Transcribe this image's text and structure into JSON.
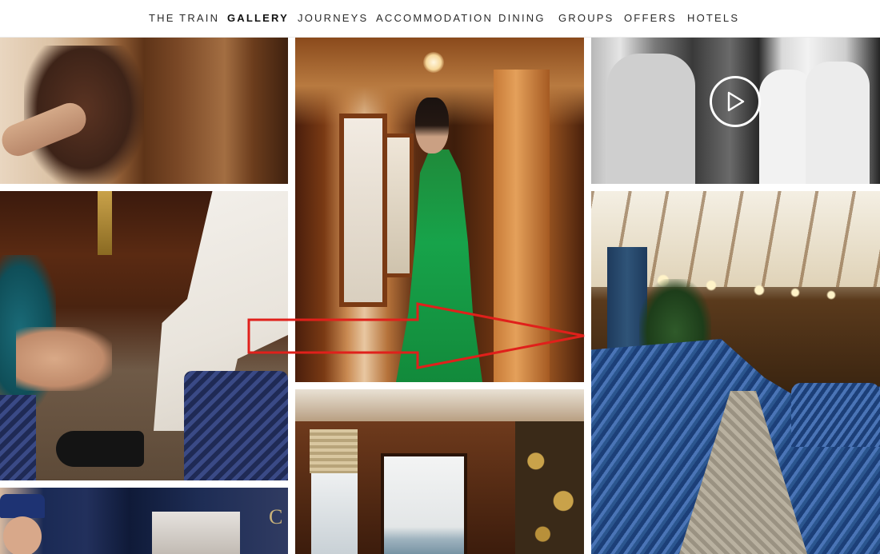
{
  "nav": {
    "items": [
      {
        "label": "THE TRAIN",
        "active": false
      },
      {
        "label": "GALLERY",
        "active": true
      },
      {
        "label": "JOURNEYS",
        "active": false
      },
      {
        "label": "ACCOMMODATION",
        "active": false
      },
      {
        "label": "DINING",
        "active": false
      },
      {
        "label": "GROUPS",
        "active": false
      },
      {
        "label": "OFFERS",
        "active": false
      },
      {
        "label": "HOTELS",
        "active": false
      }
    ]
  },
  "gallery": {
    "tiles": [
      {
        "subject": "woman leaning out of corridor window"
      },
      {
        "subject": "bar lounge with drinks"
      },
      {
        "subject": "train conductor by carriage"
      },
      {
        "subject": "woman in green dress in corridor"
      },
      {
        "subject": "compartment window"
      },
      {
        "subject": "staff serving drinks",
        "video": true
      },
      {
        "subject": "blue velvet salon car"
      }
    ],
    "carriage_lettering": "C"
  },
  "colors": {
    "annotation_arrow": "#e0201b",
    "nav_text": "#2a2a2a",
    "background": "#ffffff"
  },
  "icons": {
    "play": "play-icon"
  }
}
